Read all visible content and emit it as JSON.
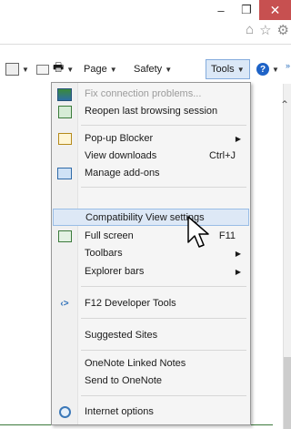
{
  "window": {
    "minimize_glyph": "–",
    "maximize_glyph": "❐",
    "close_glyph": "✕"
  },
  "address_icons": [
    "home-icon",
    "favorites-icon",
    "settings-icon"
  ],
  "commandbar": {
    "page_label": "Page",
    "safety_label": "Safety",
    "tools_label": "Tools",
    "help_glyph": "?"
  },
  "menu": {
    "items": [
      {
        "label": "Fix connection problems...",
        "disabled": true,
        "icon": "network-diagnostic-icon"
      },
      {
        "label": "Reopen last browsing session",
        "icon": "reopen-session-icon"
      },
      {
        "label": "Pop-up Blocker",
        "icon": "popup-blocker-icon",
        "submenu": true
      },
      {
        "label": "View downloads",
        "shortcut": "Ctrl+J"
      },
      {
        "label": "Manage add-ons",
        "icon": "add-ons-icon"
      },
      {
        "label": "Compatibility View settings",
        "highlighted": true
      },
      {
        "label": "Full screen",
        "shortcut": "F11",
        "icon": "full-screen-icon"
      },
      {
        "label": "Toolbars",
        "submenu": true
      },
      {
        "label": "Explorer bars",
        "submenu": true
      },
      {
        "label": "F12 Developer Tools",
        "icon": "developer-tools-icon"
      },
      {
        "label": "Suggested Sites"
      },
      {
        "label": "OneNote Linked Notes"
      },
      {
        "label": "Send to OneNote"
      },
      {
        "label": "Internet options",
        "icon": "internet-options-icon"
      }
    ],
    "submenu_glyph": "▶"
  },
  "colors": {
    "close_button": "#c75050",
    "tools_highlight": "#dbe8f7",
    "menu_highlight": "#dde8f6"
  }
}
